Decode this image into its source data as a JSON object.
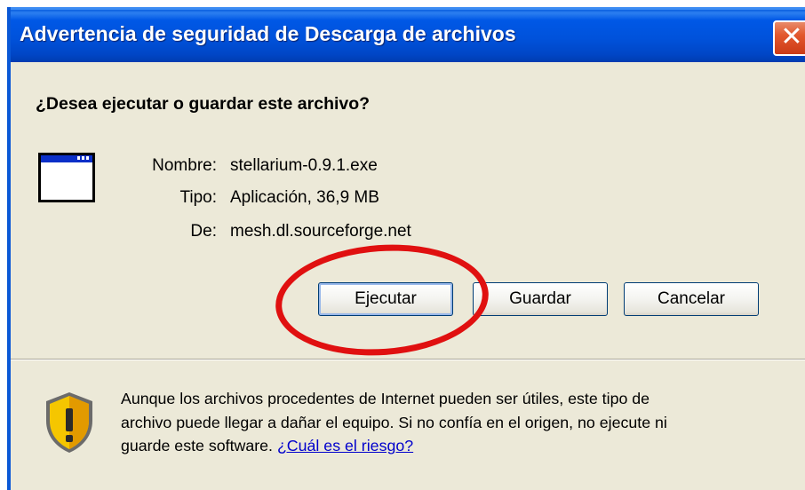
{
  "window": {
    "title": "Advertencia de seguridad de Descarga de archivos",
    "close_glyph": "✕"
  },
  "dialog": {
    "question": "¿Desea ejecutar o guardar este archivo?",
    "file_icon": "application-window-icon",
    "fields": [
      {
        "label": "Nombre:",
        "value": "stellarium-0.9.1.exe"
      },
      {
        "label": "Tipo:",
        "value": "Aplicación, 36,9 MB"
      },
      {
        "label": "De:",
        "value": "mesh.dl.sourceforge.net"
      }
    ],
    "buttons": {
      "run": "Ejecutar",
      "save": "Guardar",
      "cancel": "Cancelar"
    },
    "warning_icon": "security-shield-icon",
    "warning_text": "Aunque los archivos procedentes de Internet pueden ser útiles, este tipo de archivo puede llegar a dañar el equipo. Si no confía en el origen, no ejecute ni guarde este software. ",
    "risk_link": "¿Cuál es el riesgo?"
  },
  "colors": {
    "titlebar": "#0054e3",
    "dialog_bg": "#ece9d8",
    "annotation": "#e01010",
    "link": "#0000cc"
  }
}
